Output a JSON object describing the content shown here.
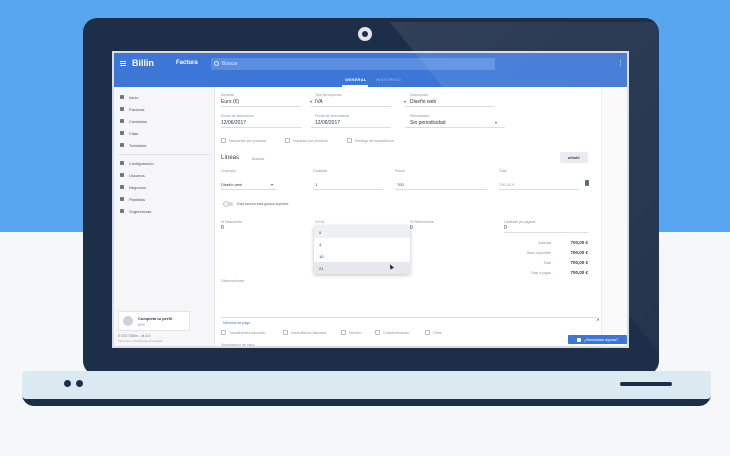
{
  "app": {
    "logo": "Billin",
    "title": "Factura",
    "search_placeholder": "Buscar"
  },
  "tabs": [
    {
      "label": "GENERAL",
      "active": true
    },
    {
      "label": "HISTÓRICO",
      "active": false
    }
  ],
  "sidebar": {
    "items": [
      {
        "label": "Inicio",
        "icon": "home-icon"
      },
      {
        "label": "Facturas",
        "icon": "document-icon"
      },
      {
        "label": "Contactos",
        "icon": "contacts-icon"
      },
      {
        "label": "Citas",
        "icon": "calendar-icon"
      },
      {
        "label": "Tutoriales",
        "icon": "play-icon"
      }
    ],
    "items2": [
      {
        "label": "Configuración",
        "icon": "gear-icon"
      },
      {
        "label": "Usuarios",
        "icon": "users-icon"
      },
      {
        "label": "Negocios",
        "icon": "briefcase-icon"
      },
      {
        "label": "Plantillas",
        "icon": "template-icon"
      },
      {
        "label": "Sugerencias",
        "icon": "chat-icon"
      }
    ],
    "profile": {
      "title": "Completa tu perfil",
      "sub": "80%"
    },
    "copyright": "© 2017 Billin - v4.0.0",
    "footer_links": "Términos y Política de privacidad"
  },
  "form": {
    "moneda_label": "Moneda",
    "moneda_value": "Euro (€)",
    "impuesto_label": "Tipo de impuesto",
    "impuesto_value": "IVA",
    "descripcion_label": "Descripción",
    "descripcion_value": "Diseño web",
    "fecha_fact_label": "Fecha de facturación",
    "fecha_fact_value": "12/06/2017",
    "fecha_venc_label": "Fecha de vencimiento",
    "fecha_venc_value": "12/06/2017",
    "periodicidad_label": "Periodicidad",
    "periodicidad_value": "Sin periodicidad",
    "checks": [
      "Descuento por producto",
      "Impuesto por producto",
      "Recargo de equivalencia"
    ]
  },
  "lines": {
    "title": "Líneas",
    "search": "Buscar",
    "add_button": "añadir",
    "headers": [
      "Concepto",
      "Cantidad",
      "Precio",
      "Total"
    ],
    "row": {
      "concepto": "Diseño web",
      "cantidad": "1",
      "precio": "700",
      "total": "700,00 €"
    },
    "toggle_label": "Esta factura está gastos suplidos"
  },
  "summary": {
    "descuento_label": "% Descuento",
    "descuento_value": "0",
    "iva_label": "% IVA",
    "retenciones_label": "% Retenciones",
    "retenciones_value": "0",
    "pagada_label": "Cantidad ya pagada",
    "pagada_value": "0",
    "iva_options": [
      "0",
      "4",
      "10",
      "21"
    ],
    "totals": [
      {
        "label": "Subtotal",
        "value": "700,00 €"
      },
      {
        "label": "Base imponible",
        "value": "700,00 €"
      },
      {
        "label": "Total",
        "value": "700,00 €"
      },
      {
        "label": "Total a pagar",
        "value": "700,00 €"
      }
    ],
    "observaciones_label": "Observaciones"
  },
  "payment": {
    "title": "Métodos de pago",
    "methods": [
      "Transferencia bancaria",
      "Domiciliación bancaria",
      "Efectivo",
      "Contrarrembolso",
      "Otros"
    ],
    "recordatorio": "Recordatorio de pago"
  },
  "help_button": "¿Necesitas ayuda?"
}
